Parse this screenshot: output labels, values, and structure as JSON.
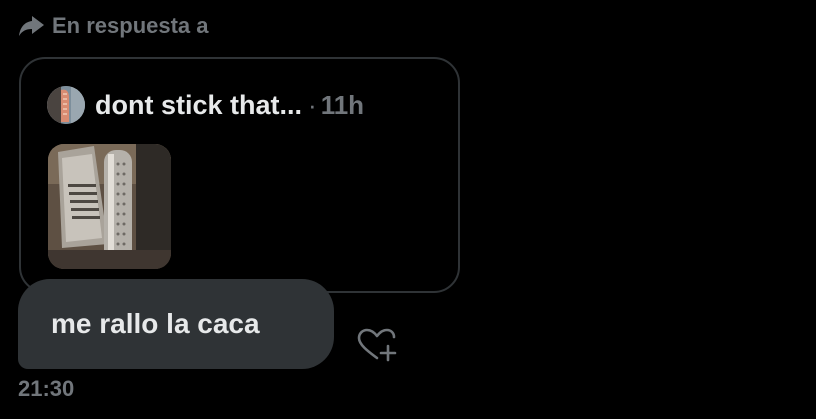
{
  "reply_context": {
    "label": "En respuesta a",
    "icon": "reply-arrow-icon"
  },
  "quoted_post": {
    "author": "dont stick that...",
    "separator": "·",
    "time_ago": "11h",
    "avatar_icon": "avatar",
    "media": "grater-photo"
  },
  "message": {
    "text": "me rallo la caca",
    "timestamp": "21:30"
  },
  "actions": {
    "react_icon": "heart-plus-icon"
  },
  "colors": {
    "background": "#000000",
    "bubble": "#2f3336",
    "border": "#2f3336",
    "primary_text": "#e7e9ea",
    "secondary_text": "#71767b"
  }
}
